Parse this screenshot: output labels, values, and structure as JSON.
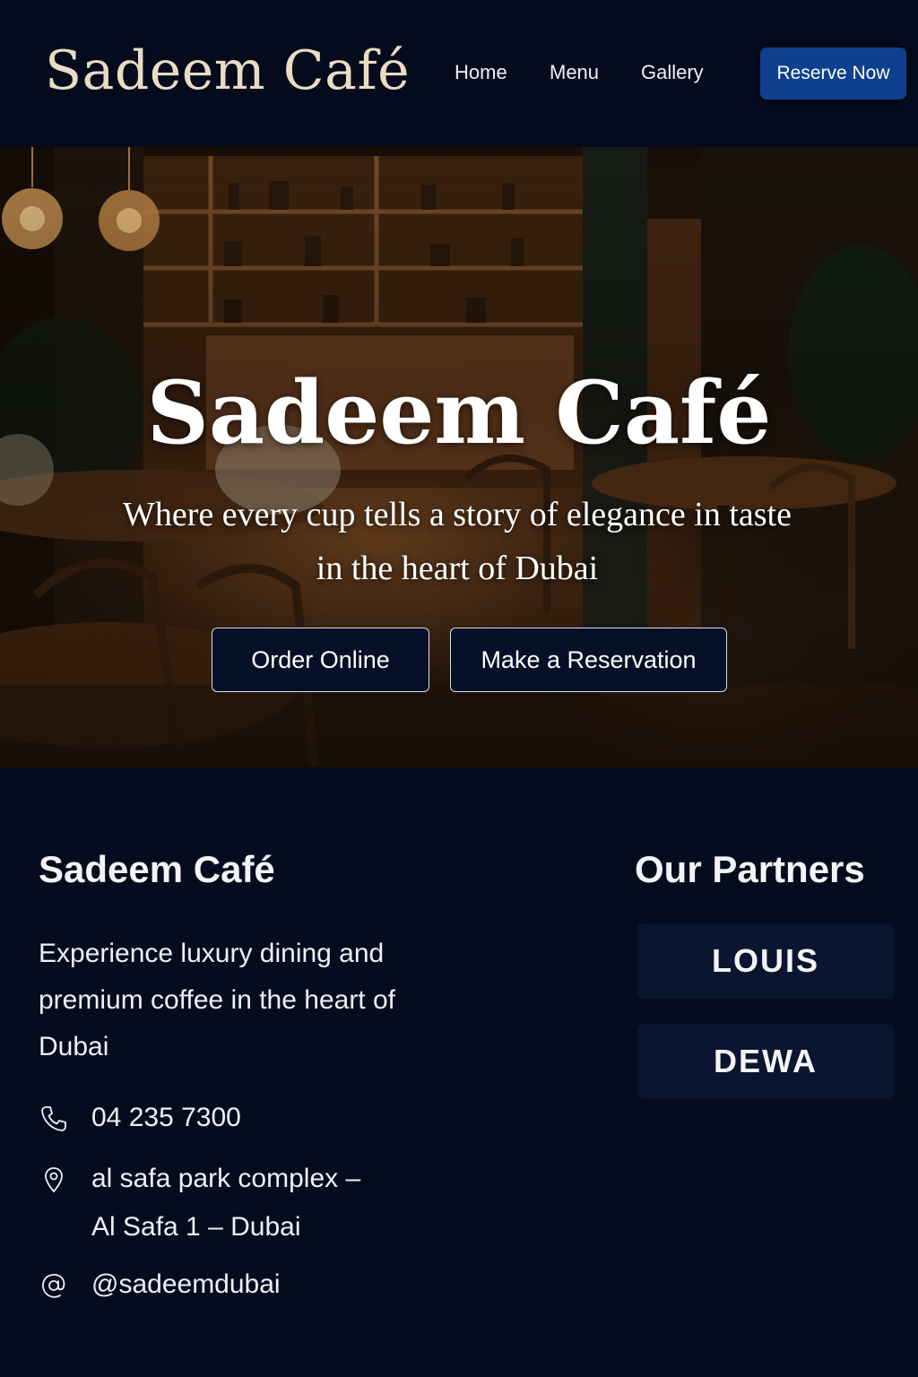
{
  "header": {
    "brand": "Sadeem Café",
    "nav": [
      {
        "label": "Home"
      },
      {
        "label": "Menu"
      },
      {
        "label": "Gallery"
      }
    ],
    "cta_label": "Reserve Now"
  },
  "hero": {
    "title": "Sadeem Café",
    "subtitle_line1": "Where every cup tells a story of elegance in taste",
    "subtitle_line2": "in the heart of Dubai",
    "buttons": [
      {
        "label": "Order Online"
      },
      {
        "label": "Make a Reservation"
      }
    ]
  },
  "info": {
    "title": "Sadeem Café",
    "description": "Experience luxury dining and premium coffee in the heart of Dubai",
    "contacts": {
      "phone": {
        "icon": "phone-icon",
        "text": "04 235 7300"
      },
      "address": {
        "icon": "location-pin-icon",
        "line1": "al safa park complex –",
        "line2": "Al Safa 1 – Dubai"
      },
      "social": {
        "icon": "at-sign-icon",
        "text": "@sadeemdubai"
      }
    }
  },
  "partners": {
    "title": "Our Partners",
    "items": [
      {
        "name": "LOUIS"
      },
      {
        "name": "DEWA"
      }
    ]
  },
  "colors": {
    "background": "#050c1d",
    "brand_gold": "#eadcc4",
    "cta_blue": "#0f3f8f",
    "card": "#0a1530"
  }
}
